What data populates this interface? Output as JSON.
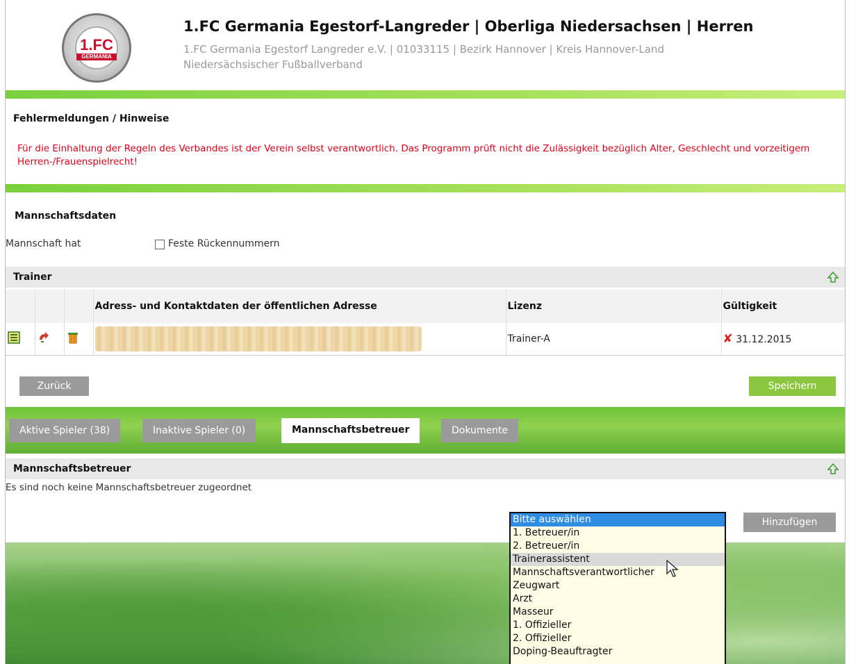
{
  "header": {
    "title": "1.FC Germania Egestorf-Langreder | Oberliga Niedersachsen | Herren",
    "subtitle_line1": "1.FC Germania Egestorf Langreder e.V. | 01033115 | Bezirk Hannover | Kreis Hannover-Land",
    "subtitle_line2": "Niedersächsischer Fußballverband",
    "logo_text": "1.FC",
    "logo_subtext": "GERMANIA"
  },
  "errors": {
    "title": "Fehlermeldungen / Hinweise",
    "message": "Für die Einhaltung der Regeln des Verbandes ist der Verein selbst verantwortlich. Das Programm prüft nicht die Zulässigkeit bezüglich Alter, Geschlecht und vorzeitigem Herren-/Frauenspielrecht!"
  },
  "team_data": {
    "title": "Mannschaftsdaten",
    "has_label": "Mannschaft hat",
    "fixed_numbers_label": "Feste Rückennummern",
    "fixed_numbers_checked": false
  },
  "trainer": {
    "title": "Trainer",
    "columns": [
      "Adress- und Kontaktdaten der öffentlichen Adresse",
      "Lizenz",
      "Gültigkeit"
    ],
    "rows": [
      {
        "license": "Trainer-A",
        "valid_until": "31.12.2015",
        "valid": false
      }
    ]
  },
  "actions": {
    "back_label": "Zurück",
    "save_label": "Speichern"
  },
  "tabs": [
    {
      "label": "Aktive Spieler (38)",
      "active": false
    },
    {
      "label": "Inaktive Spieler (0)",
      "active": false
    },
    {
      "label": "Mannschaftsbetreuer",
      "active": true
    },
    {
      "label": "Dokumente",
      "active": false
    }
  ],
  "staff": {
    "title": "Mannschaftsbetreuer",
    "empty_message": "Es sind noch keine Mannschaftsbetreuer zugeordnet",
    "add_label": "Hinzufügen",
    "dropdown_options": [
      "Bitte auswählen",
      "1. Betreuer/in",
      "2. Betreuer/in",
      "Trainerassistent",
      "Mannschaftsverantwortlicher",
      "Zeugwart",
      "Arzt",
      "Masseur",
      "1. Offizieller",
      "2. Offizieller",
      "Doping-Beauftragter"
    ],
    "selected_option": "Bitte auswählen",
    "hovered_option": "Trainerassistent"
  },
  "colors": {
    "accent_green": "#8cc63f",
    "error_red": "#e0001a",
    "selection_blue": "#2f8de4"
  }
}
